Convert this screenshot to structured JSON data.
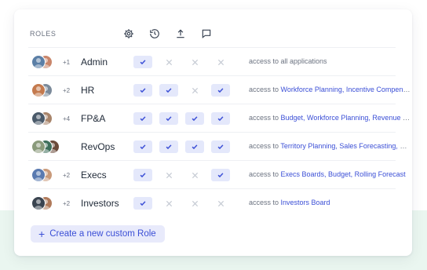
{
  "header": {
    "roles_label": "ROLES",
    "columns": [
      {
        "icon": "gear-icon"
      },
      {
        "icon": "history-icon"
      },
      {
        "icon": "upload-icon"
      },
      {
        "icon": "comment-icon"
      }
    ]
  },
  "roles": [
    {
      "name": "Admin",
      "extra": "+1",
      "avatar_colors": [
        "#5b7fa6",
        "#c9866b"
      ],
      "perms": [
        true,
        false,
        false,
        false
      ],
      "access_prefix": "access to all applications",
      "access_apps": ""
    },
    {
      "name": "HR",
      "extra": "+2",
      "avatar_colors": [
        "#c47a4e",
        "#7b8a9a"
      ],
      "perms": [
        true,
        true,
        false,
        true
      ],
      "access_prefix": "access to ",
      "access_apps": "Workforce Planning, Incentive Compensation"
    },
    {
      "name": "FP&A",
      "extra": "+4",
      "avatar_colors": [
        "#4a5a6a",
        "#a8846a"
      ],
      "perms": [
        true,
        true,
        true,
        true
      ],
      "access_prefix": "access to ",
      "access_apps": "Budget, Workforce Planning, Revenue Planning"
    },
    {
      "name": "RevOps",
      "extra": "",
      "avatar_colors": [
        "#8a9a7b",
        "#3d6e5a",
        "#6b4a3a"
      ],
      "perms": [
        true,
        true,
        true,
        true
      ],
      "access_prefix": "access to ",
      "access_apps": "Territory Planning, Sales Forecasting, Quota"
    },
    {
      "name": "Execs",
      "extra": "+2",
      "avatar_colors": [
        "#5a7ab0",
        "#c99a7a"
      ],
      "perms": [
        true,
        false,
        false,
        true
      ],
      "access_prefix": "access to ",
      "access_apps": "Execs Boards, Budget, Rolling Forecast"
    },
    {
      "name": "Investors",
      "extra": "+2",
      "avatar_colors": [
        "#3a4450",
        "#b07a5a"
      ],
      "perms": [
        true,
        false,
        false,
        false
      ],
      "access_prefix": "access to ",
      "access_apps": "Investors Board"
    }
  ],
  "create_button": {
    "label": "Create a new custom Role",
    "icon": "plus-icon"
  },
  "colors": {
    "accent": "#3b4fd6",
    "check_bg": "#e4e8fb",
    "mint_bg": "#eaf6f0"
  }
}
